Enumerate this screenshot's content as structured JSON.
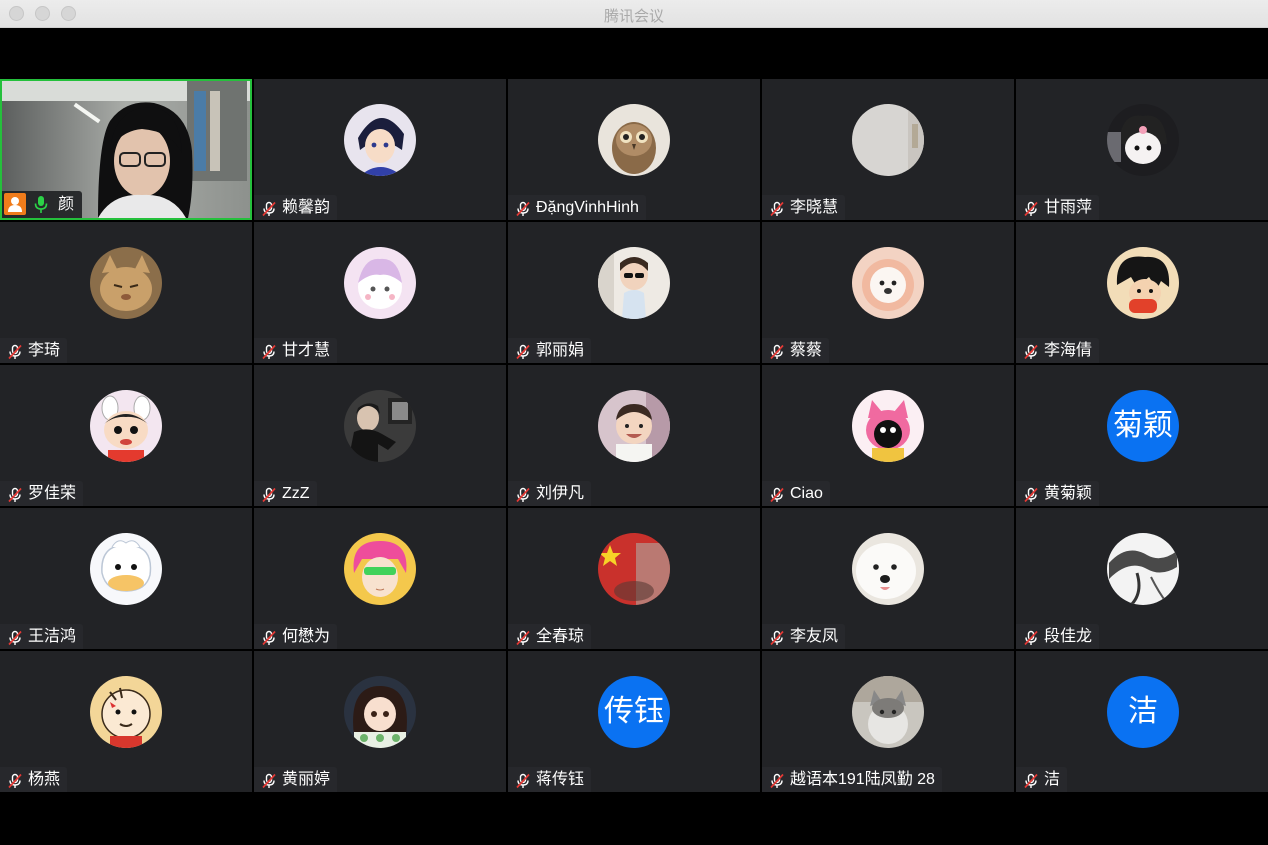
{
  "window": {
    "title": "腾讯会议"
  },
  "participants": [
    {
      "name": "颜",
      "self": true,
      "avatar": "webcam-video"
    },
    {
      "name": "赖馨韵",
      "avatar": "anime-boy-avatar"
    },
    {
      "name": "ĐặngVinhHinh",
      "avatar": "owl-avatar"
    },
    {
      "name": "李晓慧",
      "avatar": "grey-photo-avatar"
    },
    {
      "name": "甘雨萍",
      "avatar": "kuromi-avatar"
    },
    {
      "name": "李琦",
      "avatar": "cat-avatar"
    },
    {
      "name": "甘才慧",
      "avatar": "pink-cartoon-avatar"
    },
    {
      "name": "郭丽娟",
      "avatar": "child-sunglasses-avatar"
    },
    {
      "name": "蔡蔡",
      "avatar": "dog-flower-avatar"
    },
    {
      "name": "李海倩",
      "avatar": "cartoon-kid-avatar"
    },
    {
      "name": "罗佳荣",
      "avatar": "crayon-shin-avatar"
    },
    {
      "name": "ZzZ",
      "avatar": "man-photo-avatar"
    },
    {
      "name": "刘伊凡",
      "avatar": "baby-photo-avatar"
    },
    {
      "name": "Ciao",
      "avatar": "pink-character-avatar"
    },
    {
      "name": "黄菊颖",
      "avatar": "initial-avatar",
      "initial": "菊颖"
    },
    {
      "name": "王洁鸿",
      "avatar": "duck-avatar"
    },
    {
      "name": "何懋为",
      "avatar": "saiki-avatar"
    },
    {
      "name": "全春琼",
      "avatar": "flag-avatar"
    },
    {
      "name": "李友凤",
      "avatar": "samoyed-avatar"
    },
    {
      "name": "段佳龙",
      "avatar": "ink-painting-avatar"
    },
    {
      "name": "杨燕",
      "avatar": "cartoon-face-avatar"
    },
    {
      "name": "黄丽婷",
      "avatar": "anime-girl-avatar"
    },
    {
      "name": "蒋传钰",
      "avatar": "initial-avatar",
      "initial": "传钰"
    },
    {
      "name": "越语本191陆凤勤 28",
      "avatar": "grey-cat-avatar"
    },
    {
      "name": "洁",
      "avatar": "initial-avatar",
      "initial": "洁"
    }
  ],
  "colors": {
    "tile_bg": "#222326",
    "active_speaker_border": "#25c03c",
    "initial_avatar_bg": "#0a72f2",
    "host_badge": "#f07c1b",
    "mic_active": "#2bd247",
    "mic_muted": "#ffffff"
  }
}
